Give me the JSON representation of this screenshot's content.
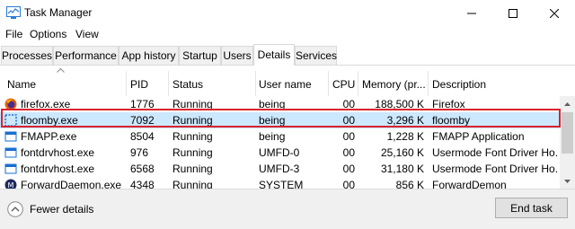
{
  "window": {
    "title": "Task Manager"
  },
  "menu": [
    "File",
    "Options",
    "View"
  ],
  "tabs": [
    "Processes",
    "Performance",
    "App history",
    "Startup",
    "Users",
    "Details",
    "Services"
  ],
  "active_tab": "Details",
  "columns": [
    "Name",
    "PID",
    "Status",
    "User name",
    "CPU",
    "Memory (pr...",
    "Description"
  ],
  "rows": [
    {
      "name": "firefox.exe",
      "pid": "1776",
      "status": "Running",
      "user": "being",
      "cpu": "00",
      "memory": "188,500 K",
      "description": "Firefox",
      "icon": "firefox-icon"
    },
    {
      "name": "floomby.exe",
      "pid": "7092",
      "status": "Running",
      "user": "being",
      "cpu": "00",
      "memory": "3,296 K",
      "description": "floomby",
      "icon": "dotted-app-icon"
    },
    {
      "name": "FMAPP.exe",
      "pid": "8504",
      "status": "Running",
      "user": "being",
      "cpu": "00",
      "memory": "1,228 K",
      "description": "FMAPP Application",
      "icon": "app-window-icon"
    },
    {
      "name": "fontdrvhost.exe",
      "pid": "976",
      "status": "Running",
      "user": "UMFD-0",
      "cpu": "00",
      "memory": "25,160 K",
      "description": "Usermode Font Driver Ho...",
      "icon": "app-window-icon"
    },
    {
      "name": "fontdrvhost.exe",
      "pid": "6568",
      "status": "Running",
      "user": "UMFD-3",
      "cpu": "00",
      "memory": "31,180 K",
      "description": "Usermode Font Driver Ho...",
      "icon": "app-window-icon"
    },
    {
      "name": "ForwardDaemon.exe",
      "pid": "4348",
      "status": "Running",
      "user": "SYSTEM",
      "cpu": "00",
      "memory": "856 K",
      "description": "ForwardDemon",
      "icon": "forward-daemon-icon"
    }
  ],
  "selected_row": "floomby.exe",
  "footer": {
    "fewer_details": "Fewer details",
    "end_task": "End task"
  },
  "colors": {
    "selection": "#cce8ff",
    "highlight_border": "#d9232e",
    "tab_bar": "#f0f0f0"
  }
}
